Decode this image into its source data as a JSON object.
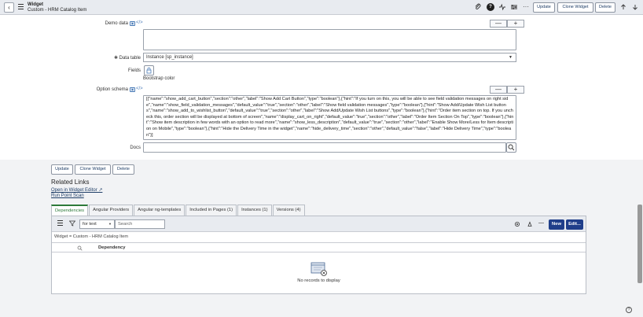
{
  "header": {
    "record_type": "Widget",
    "record_name": "Custom - HRM Catalog Item",
    "back_glyph": "‹",
    "buttons": {
      "update": "Update",
      "clone": "Clone Widget",
      "delete": "Delete"
    },
    "icons": [
      "paperclip-icon",
      "help-icon",
      "activity-icon",
      "sliders-icon",
      "more-icon",
      "arrow-up-icon",
      "arrow-down-icon"
    ]
  },
  "form": {
    "demo_data_label": "Demo data",
    "data_table_label": "Data table",
    "data_table_value": "Instance [sp_instance]",
    "fields_label": "Fields",
    "fields_value": "Bootstrap color",
    "option_schema_label": "Option schema",
    "option_schema_value": "[{\"name\":\"show_add_cart_button\",\"section\":\"other\",\"label\":\"Show Add Cart Button\",\"type\":\"boolean\"},{\"hint\":\"If you turn on this, you will be able to see field validation messages on right side\",\"name\":\"show_field_validation_messages\",\"default_value\":\"true\",\"section\":\"other\",\"label\":\"Show field validation messages\",\"type\":\"boolean\"},{\"hint\":\"Show Add/Update Wish List buttons\",\"name\":\"show_add_to_wishlist_button\",\"default_value\":\"true\",\"section\":\"other\",\"label\":\"Show Add/Update Wish List buttons\",\"type\":\"boolean\"},{\"hint\":\"Order item section on top. If you uncheck this, order section will be displayed at bottom of screen\",\"name\":\"display_cart_on_right\",\"default_value\":\"true\",\"section\":\"other\",\"label\":\"Order Item Section On Top\",\"type\":\"boolean\"},{\"hint\":\"Show item description in few words with an option to read more\",\"name\":\"show_less_description\",\"default_value\":\"true\",\"section\":\"other\",\"label\":\"Enable Show More/Less for Item description on Mobile\",\"type\":\"boolean\"},{\"hint\":\"Hide the Delivery Time in the widget\",\"name\":\"hide_delivery_time\",\"section\":\"other\",\"default_value\":\"false\",\"label\":\"Hide Delivery Time\",\"type\":\"boolean\"}]",
    "docs_label": "Docs",
    "minus": "—",
    "plus": "+"
  },
  "bottom_buttons": {
    "update": "Update",
    "clone": "Clone Widget",
    "delete": "Delete"
  },
  "related_links": {
    "title": "Related Links",
    "links": [
      "Open in Widget Editor ↗",
      "Run Point Scan"
    ]
  },
  "tabs": [
    {
      "label": "Dependencies",
      "active": true
    },
    {
      "label": "Angular Providers"
    },
    {
      "label": "Angular ng-templates"
    },
    {
      "label": "Included in Pages (1)"
    },
    {
      "label": "Instances (1)"
    },
    {
      "label": "Versions (4)"
    }
  ],
  "related_list": {
    "filter_select": "for text",
    "search_placeholder": "Search",
    "new_label": "New",
    "edit_label": "Edit...",
    "breadcrumb": "Widget = Custom - HRM Catalog Item",
    "column": "Dependency",
    "empty_message": "No records to display"
  },
  "colors": {
    "accent_green": "#2d7a3a",
    "primary_button": "#1f3e8a",
    "link": "#1f3e67"
  }
}
